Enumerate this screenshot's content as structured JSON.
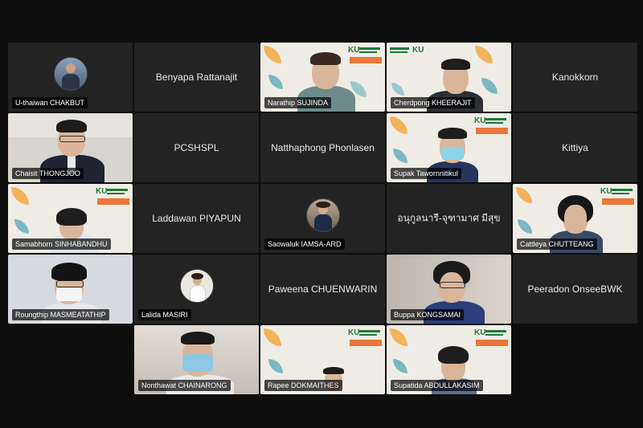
{
  "participants": [
    {
      "name": "U-thaiwan CHAKBUT",
      "mode": "avatar"
    },
    {
      "name": "Benyapa Rattanajit",
      "mode": "name-only"
    },
    {
      "name": "Narathip SUJINDA",
      "mode": "video-banner"
    },
    {
      "name": "Cherdpong KHEERAJIT",
      "mode": "video-banner"
    },
    {
      "name": "Kanokkorn",
      "mode": "name-only"
    },
    {
      "name": "Chaisit THONGJOO",
      "mode": "video"
    },
    {
      "name": "PCSHSPL",
      "mode": "name-only"
    },
    {
      "name": "Natthaphong Phonlasen",
      "mode": "name-only"
    },
    {
      "name": "Supak Tawornnitikul",
      "mode": "video-banner"
    },
    {
      "name": "Kittiya",
      "mode": "name-only"
    },
    {
      "name": "Samabhorn SINHABANDHU",
      "mode": "video-banner"
    },
    {
      "name": "Laddawan PIYAPUN",
      "mode": "name-only"
    },
    {
      "name": "Saowaluk IAMSA-ARD",
      "mode": "avatar"
    },
    {
      "name": "อนุกูลนารี-จุฑามาศ มีสุข",
      "mode": "name-only"
    },
    {
      "name": "Cattleya CHUTTEANG",
      "mode": "video-banner"
    },
    {
      "name": "Roungthip MASMEATATHIP",
      "mode": "video"
    },
    {
      "name": "Lalida MASIRI",
      "mode": "avatar"
    },
    {
      "name": "Paweena CHUENWARIN",
      "mode": "name-only"
    },
    {
      "name": "Buppa KONGSAMAI",
      "mode": "video"
    },
    {
      "name": "Peeradon OnseeBWK",
      "mode": "name-only"
    },
    {
      "name": "Nonthawat CHAINARONG",
      "mode": "video"
    },
    {
      "name": "Rapee DOKMAITHES",
      "mode": "video-banner"
    },
    {
      "name": "Supatida ABDULLAKASIM",
      "mode": "video-banner"
    }
  ],
  "branding": {
    "ku_mark": "KU"
  },
  "colors": {
    "tile_bg": "#232323",
    "page_bg": "#0e0e0e",
    "banner_green": "#1f7a3a",
    "banner_orange": "#e9773a"
  }
}
